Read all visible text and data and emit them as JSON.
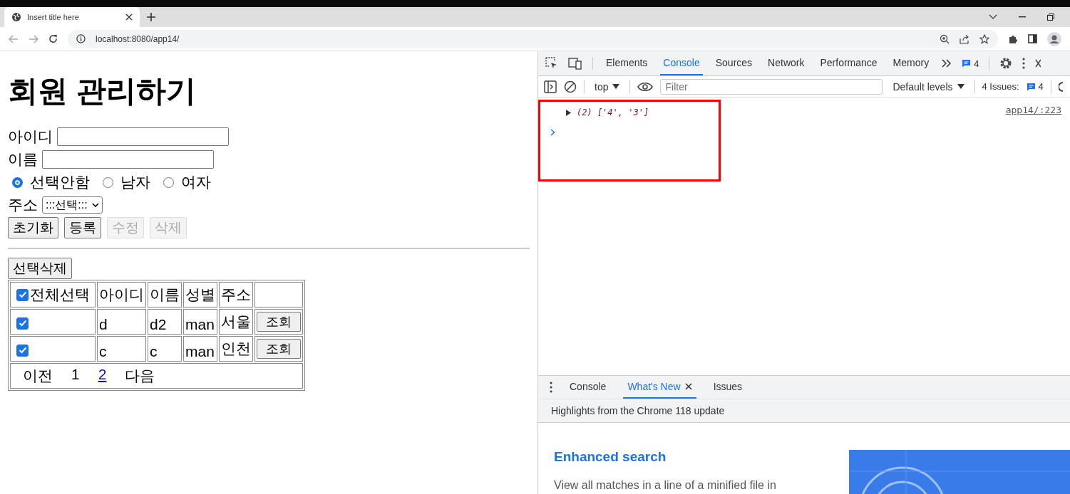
{
  "browser": {
    "tab_title": "Insert title here",
    "address": "localhost:8080/app14/"
  },
  "page": {
    "heading": "회원 관리하기",
    "id_label": "아이디",
    "name_label": "이름",
    "gender_options": [
      {
        "label": "선택안함",
        "selected": true
      },
      {
        "label": "남자",
        "selected": false
      },
      {
        "label": "여자",
        "selected": false
      }
    ],
    "address_label": "주소",
    "address_select": ":::선택:::",
    "buttons": [
      {
        "label": "초기화",
        "disabled": false
      },
      {
        "label": "등록",
        "disabled": false
      },
      {
        "label": "수정",
        "disabled": true
      },
      {
        "label": "삭제",
        "disabled": true
      }
    ],
    "delete_selected": "선택삭제",
    "table": {
      "select_all": {
        "label": "전체선택",
        "checked": true
      },
      "columns": [
        "아이디",
        "이름",
        "성별",
        "주소"
      ],
      "rows": [
        {
          "checked": true,
          "id": "d",
          "name": "d2",
          "gender": "man",
          "address": "서울",
          "action": "조회"
        },
        {
          "checked": true,
          "id": "c",
          "name": "c",
          "gender": "man",
          "address": "인천",
          "action": "조회"
        }
      ],
      "pagination": {
        "prev": "이전",
        "pages": [
          {
            "label": "1",
            "selected": true
          },
          {
            "label": "2",
            "selected": false
          }
        ],
        "next": "다음"
      }
    }
  },
  "devtools": {
    "tabs": [
      {
        "label": "Elements",
        "selected": false
      },
      {
        "label": "Console",
        "selected": true
      },
      {
        "label": "Sources",
        "selected": false
      },
      {
        "label": "Network",
        "selected": false
      },
      {
        "label": "Performance",
        "selected": false
      },
      {
        "label": "Memory",
        "selected": false
      }
    ],
    "message_count": "4",
    "context": "top",
    "filter_placeholder": "Filter",
    "levels": "Default levels",
    "issues_label": "4 Issues:",
    "issues_count": "4",
    "console": [
      {
        "text": "(2) ['4', '3']",
        "source": "app14/:223"
      }
    ],
    "drawer_tabs": [
      {
        "label": "Console",
        "selected": false,
        "closable": false
      },
      {
        "label": "What's New",
        "selected": true,
        "closable": true
      },
      {
        "label": "Issues",
        "selected": false,
        "closable": false
      }
    ],
    "highlights": "Highlights from the Chrome 118 update",
    "article_title": "Enhanced search",
    "article_text": "View all matches in a line of a minified file in"
  }
}
